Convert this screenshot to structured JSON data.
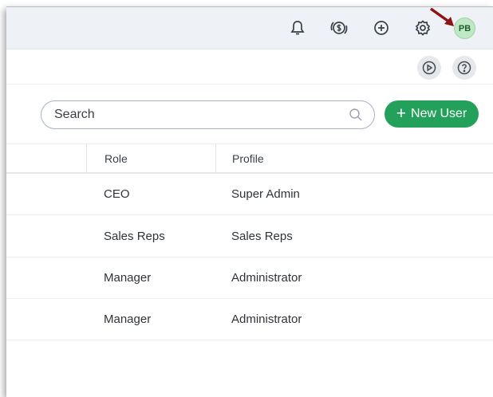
{
  "header": {
    "icons": [
      "bell-icon",
      "coin-sync-icon",
      "add-circle-icon",
      "gear-icon"
    ],
    "avatar_initials": "PB",
    "avatar_color": "#bfe8c5"
  },
  "subheader": {
    "icons": [
      "play-icon",
      "help-icon"
    ]
  },
  "toolbar": {
    "search_placeholder": "Search",
    "new_user_plus": "+",
    "new_user_label": "New User",
    "accent": "#23a05a"
  },
  "table": {
    "columns": [
      "Role",
      "Profile"
    ],
    "rows": [
      {
        "role": "CEO",
        "profile": "Super Admin"
      },
      {
        "role": "Sales Reps",
        "profile": "Sales Reps"
      },
      {
        "role": "Manager",
        "profile": "Administrator"
      },
      {
        "role": "Manager",
        "profile": "Administrator"
      }
    ]
  }
}
